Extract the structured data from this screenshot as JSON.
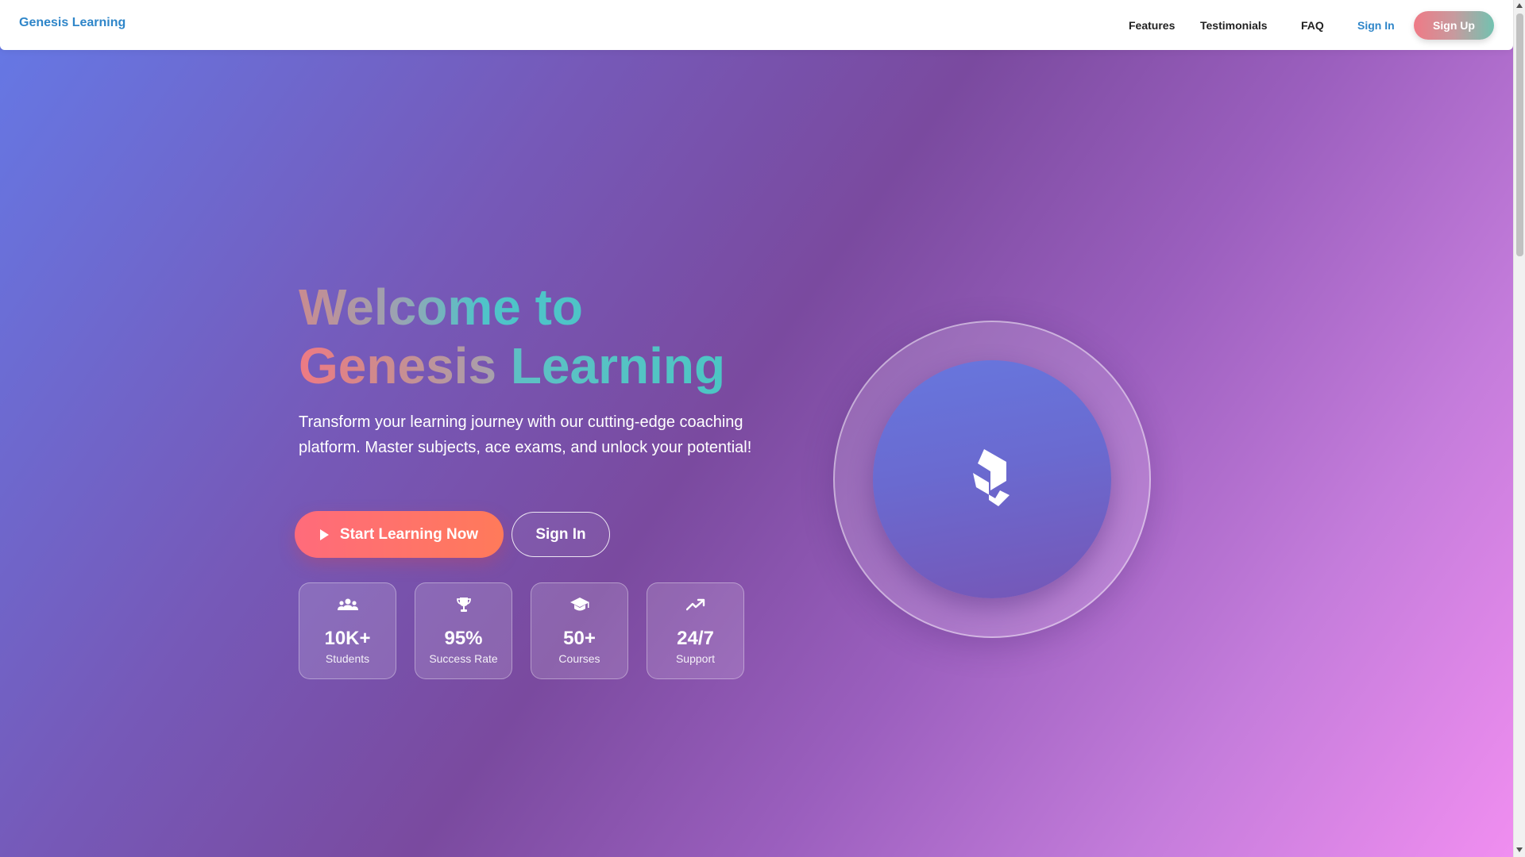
{
  "nav": {
    "brand": "Genesis Learning",
    "links": [
      "Features",
      "Testimonials",
      "FAQ"
    ],
    "sign_in": "Sign In",
    "sign_up": "Sign Up"
  },
  "hero": {
    "title_line1": "Welcome to",
    "title_line2a": "Genesis",
    "title_line2b": "Learning",
    "description": "Transform your learning journey with our cutting-edge coaching platform. Master subjects, ace exams, and unlock your potential!",
    "primary_cta": "Start Learning Now",
    "secondary_cta": "Sign In"
  },
  "stats": [
    {
      "icon": "users-icon",
      "value": "10K+",
      "label": "Students"
    },
    {
      "icon": "trophy-icon",
      "value": "95%",
      "label": "Success Rate"
    },
    {
      "icon": "graduation-cap-icon",
      "value": "50+",
      "label": "Courses"
    },
    {
      "icon": "trending-up-icon",
      "value": "24/7",
      "label": "Support"
    }
  ],
  "colors": {
    "brand_blue": "#2f86c9",
    "cta_coral": "#ff6b7b",
    "accent_teal": "#4dc4c6",
    "bg_start": "#6579e6",
    "bg_end": "#f08ef0"
  }
}
